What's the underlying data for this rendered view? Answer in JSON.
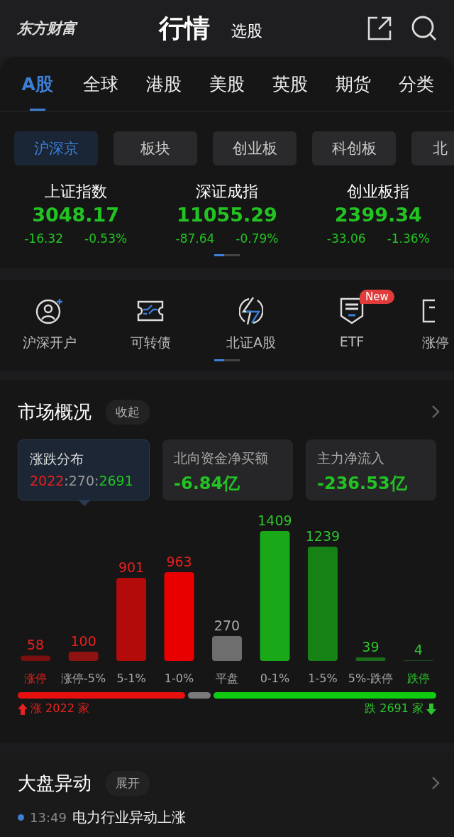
{
  "header": {
    "logo": "东方财富",
    "title": "行情",
    "subtitle": "选股"
  },
  "market_tabs": [
    {
      "label": "A股",
      "selected": true
    },
    {
      "label": "全球",
      "selected": false
    },
    {
      "label": "港股",
      "selected": false
    },
    {
      "label": "美股",
      "selected": false
    },
    {
      "label": "英股",
      "selected": false
    },
    {
      "label": "期货",
      "selected": false
    },
    {
      "label": "分类",
      "selected": false
    }
  ],
  "chips": [
    {
      "label": "沪深京",
      "selected": true
    },
    {
      "label": "板块",
      "selected": false
    },
    {
      "label": "创业板",
      "selected": false
    },
    {
      "label": "科创板",
      "selected": false
    },
    {
      "label": "北",
      "selected": false
    }
  ],
  "indices": [
    {
      "name": "上证指数",
      "value": "3048.17",
      "change": "-16.32",
      "percent": "-0.53%"
    },
    {
      "name": "深证成指",
      "value": "11055.29",
      "change": "-87.64",
      "percent": "-0.79%"
    },
    {
      "name": "创业板指",
      "value": "2399.34",
      "change": "-33.06",
      "percent": "-1.36%"
    }
  ],
  "shortcuts": [
    {
      "kind": "person-add",
      "label": "沪深开户"
    },
    {
      "kind": "ticket",
      "label": "可转债"
    },
    {
      "kind": "bolt",
      "label": "北证A股"
    },
    {
      "kind": "etf",
      "label": "ETF",
      "badge": "New"
    },
    {
      "kind": "partial",
      "label": "涨停"
    }
  ],
  "overview": {
    "title": "市场概况",
    "toggle": "收起",
    "stats": [
      {
        "title": "涨跌分布",
        "selected": true,
        "parts": [
          {
            "text": "2022",
            "kind": "up"
          },
          {
            "text": ":270:",
            "kind": "flat"
          },
          {
            "text": "2691",
            "kind": "down"
          }
        ]
      },
      {
        "title": "北向资金净买额",
        "selected": false,
        "parts": [
          {
            "text": "-6.84亿",
            "kind": "down"
          }
        ]
      },
      {
        "title": "主力净流入",
        "selected": false,
        "parts": [
          {
            "text": "-236.53亿",
            "kind": "down"
          }
        ]
      }
    ],
    "chart_data": {
      "type": "bar",
      "categories": [
        "涨停",
        "涨停-5%",
        "5-1%",
        "1-0%",
        "平盘",
        "0-1%",
        "1-5%",
        "5%-跌停",
        "跌停"
      ],
      "values": [
        58,
        100,
        901,
        963,
        270,
        1409,
        1239,
        39,
        4
      ],
      "data_labels": true
    },
    "up_total": "涨 2022 家",
    "down_total": "跌 2691 家"
  },
  "anomaly": {
    "title": "大盘异动",
    "toggle": "展开",
    "items": [
      {
        "time": "13:49",
        "text": "电力行业异动上涨"
      }
    ]
  }
}
